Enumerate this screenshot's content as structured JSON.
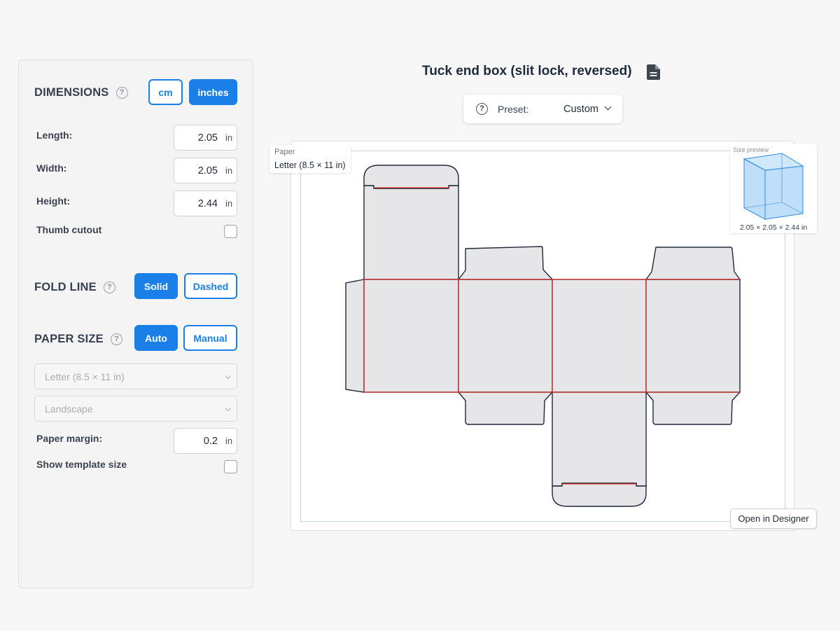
{
  "dimensions": {
    "title": "DIMENSIONS",
    "help": "?",
    "unit_cm": "cm",
    "unit_inches": "inches",
    "length_label": "Length:",
    "length_value": "2.05",
    "width_label": "Width:",
    "width_value": "2.05",
    "height_label": "Height:",
    "height_value": "2.44",
    "unit": "in",
    "thumb_cutout_label": "Thumb cutout"
  },
  "fold_line": {
    "title": "FOLD LINE",
    "help": "?",
    "solid_label": "Solid",
    "dashed_label": "Dashed"
  },
  "paper_size": {
    "title": "PAPER SIZE",
    "help": "?",
    "auto_label": "Auto",
    "manual_label": "Manual",
    "paper_select": "Letter (8.5 × 11 in)",
    "orientation_select": "Landscape",
    "margin_label": "Paper margin:",
    "margin_value": "0.2",
    "unit": "in",
    "show_template_size_label": "Show template size"
  },
  "header": {
    "title": "Tuck end box (slit lock, reversed)",
    "preset_help": "?",
    "preset_label": "Preset:",
    "preset_value": "Custom"
  },
  "canvas": {
    "paper_tag_label": "Paper",
    "paper_tag_value": "Letter (8.5 × 11 in)",
    "size_preview_label": "Size preview",
    "size_preview_dims": "2.05 × 2.05 × 2.44 in",
    "open_button": "Open in Designer"
  },
  "colors": {
    "accent": "#1a7fe6",
    "fold_line": "#e53935",
    "cut_line": "#1f2937",
    "panel_fill": "#e6e6e8"
  }
}
